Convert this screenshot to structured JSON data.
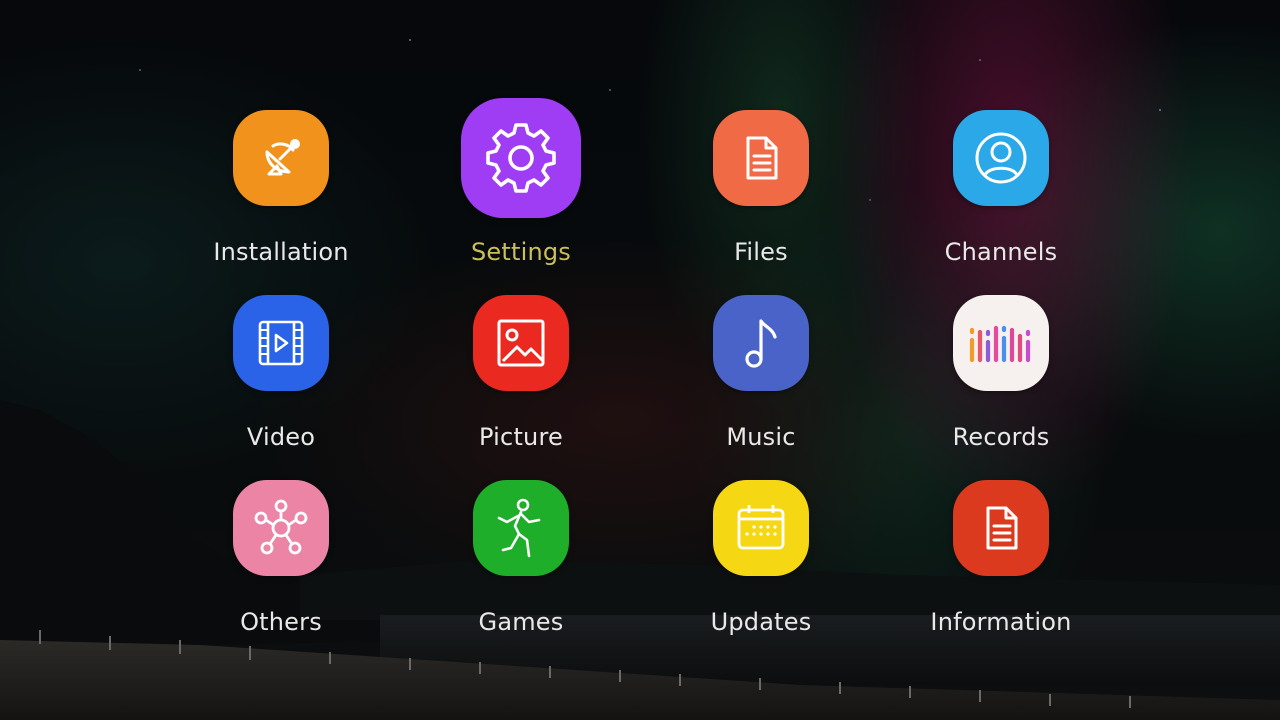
{
  "menu": {
    "focused_index": 1,
    "label_color": "#e9e9e9",
    "focused_label_color": "#cdbf58",
    "items": [
      {
        "label": "Installation",
        "icon": "satellite-dish-icon",
        "color": "#f0921c"
      },
      {
        "label": "Settings",
        "icon": "gear-icon",
        "color": "#9f3df5"
      },
      {
        "label": "Files",
        "icon": "document-icon",
        "color": "#ef6a45"
      },
      {
        "label": "Channels",
        "icon": "user-circle-icon",
        "color": "#2aa8e8"
      },
      {
        "label": "Video",
        "icon": "video-play-icon",
        "color": "#2a62e8"
      },
      {
        "label": "Picture",
        "icon": "picture-icon",
        "color": "#ea2a20"
      },
      {
        "label": "Music",
        "icon": "music-note-icon",
        "color": "#4a63c9"
      },
      {
        "label": "Records",
        "icon": "equalizer-bars-icon",
        "color": "#f6f0ee"
      },
      {
        "label": "Others",
        "icon": "network-nodes-icon",
        "color": "#ec84a6"
      },
      {
        "label": "Games",
        "icon": "runner-icon",
        "color": "#1fae2a"
      },
      {
        "label": "Updates",
        "icon": "calendar-icon",
        "color": "#f6d714"
      },
      {
        "label": "Information",
        "icon": "document-icon",
        "color": "#db3a1e"
      }
    ]
  }
}
